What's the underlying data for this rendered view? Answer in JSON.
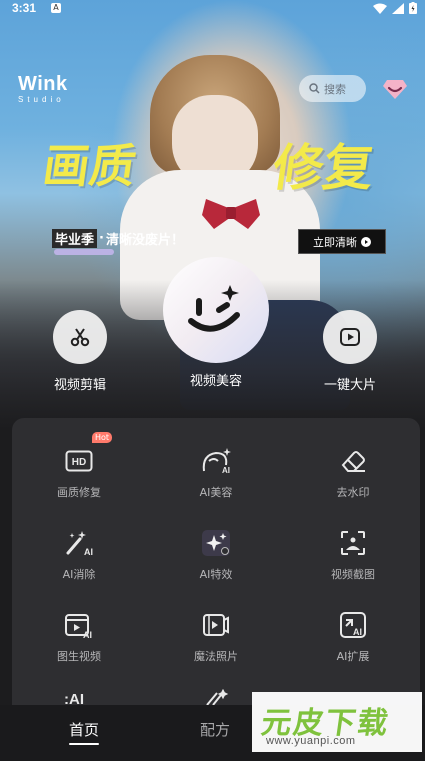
{
  "status_bar": {
    "time": "3:31",
    "notif_badge": "A"
  },
  "brand": {
    "logo_line1": "Wink",
    "logo_line2": "Studio"
  },
  "search": {
    "placeholder": "搜索"
  },
  "banner": {
    "headline_left": "画质",
    "headline_right": "修复",
    "subline_part1": "毕业季",
    "subline_part2": "清晰没废片！",
    "cta_label": "立即清晰"
  },
  "main_tools": [
    {
      "label": "视频剪辑",
      "icon": "scissors-icon"
    },
    {
      "label": "视频美容",
      "icon": "wink-face-icon"
    },
    {
      "label": "一键大片",
      "icon": "play-icon"
    }
  ],
  "features": [
    {
      "label": "画质修复",
      "icon": "hd-icon",
      "badge": "Hot"
    },
    {
      "label": "AI美容",
      "icon": "ai-beauty-icon"
    },
    {
      "label": "去水印",
      "icon": "eraser-icon"
    },
    {
      "label": "AI消除",
      "icon": "magic-wand-ai-icon"
    },
    {
      "label": "AI特效",
      "icon": "ai-effects-icon"
    },
    {
      "label": "视频截图",
      "icon": "video-screenshot-icon"
    },
    {
      "label": "图生视频",
      "icon": "image-to-video-icon"
    },
    {
      "label": "魔法照片",
      "icon": "magic-photo-icon"
    },
    {
      "label": "AI扩展",
      "icon": "ai-expand-icon"
    }
  ],
  "bottom_nav": {
    "home": "首页",
    "recipes": "配方"
  },
  "watermark": {
    "main": "元皮下载",
    "sub": "www.yuanpi.com"
  },
  "colors": {
    "headline_yellow": "#f3ea4a",
    "panel_bg": "#2e2e31",
    "hot_badge": "#ff7a6b"
  }
}
